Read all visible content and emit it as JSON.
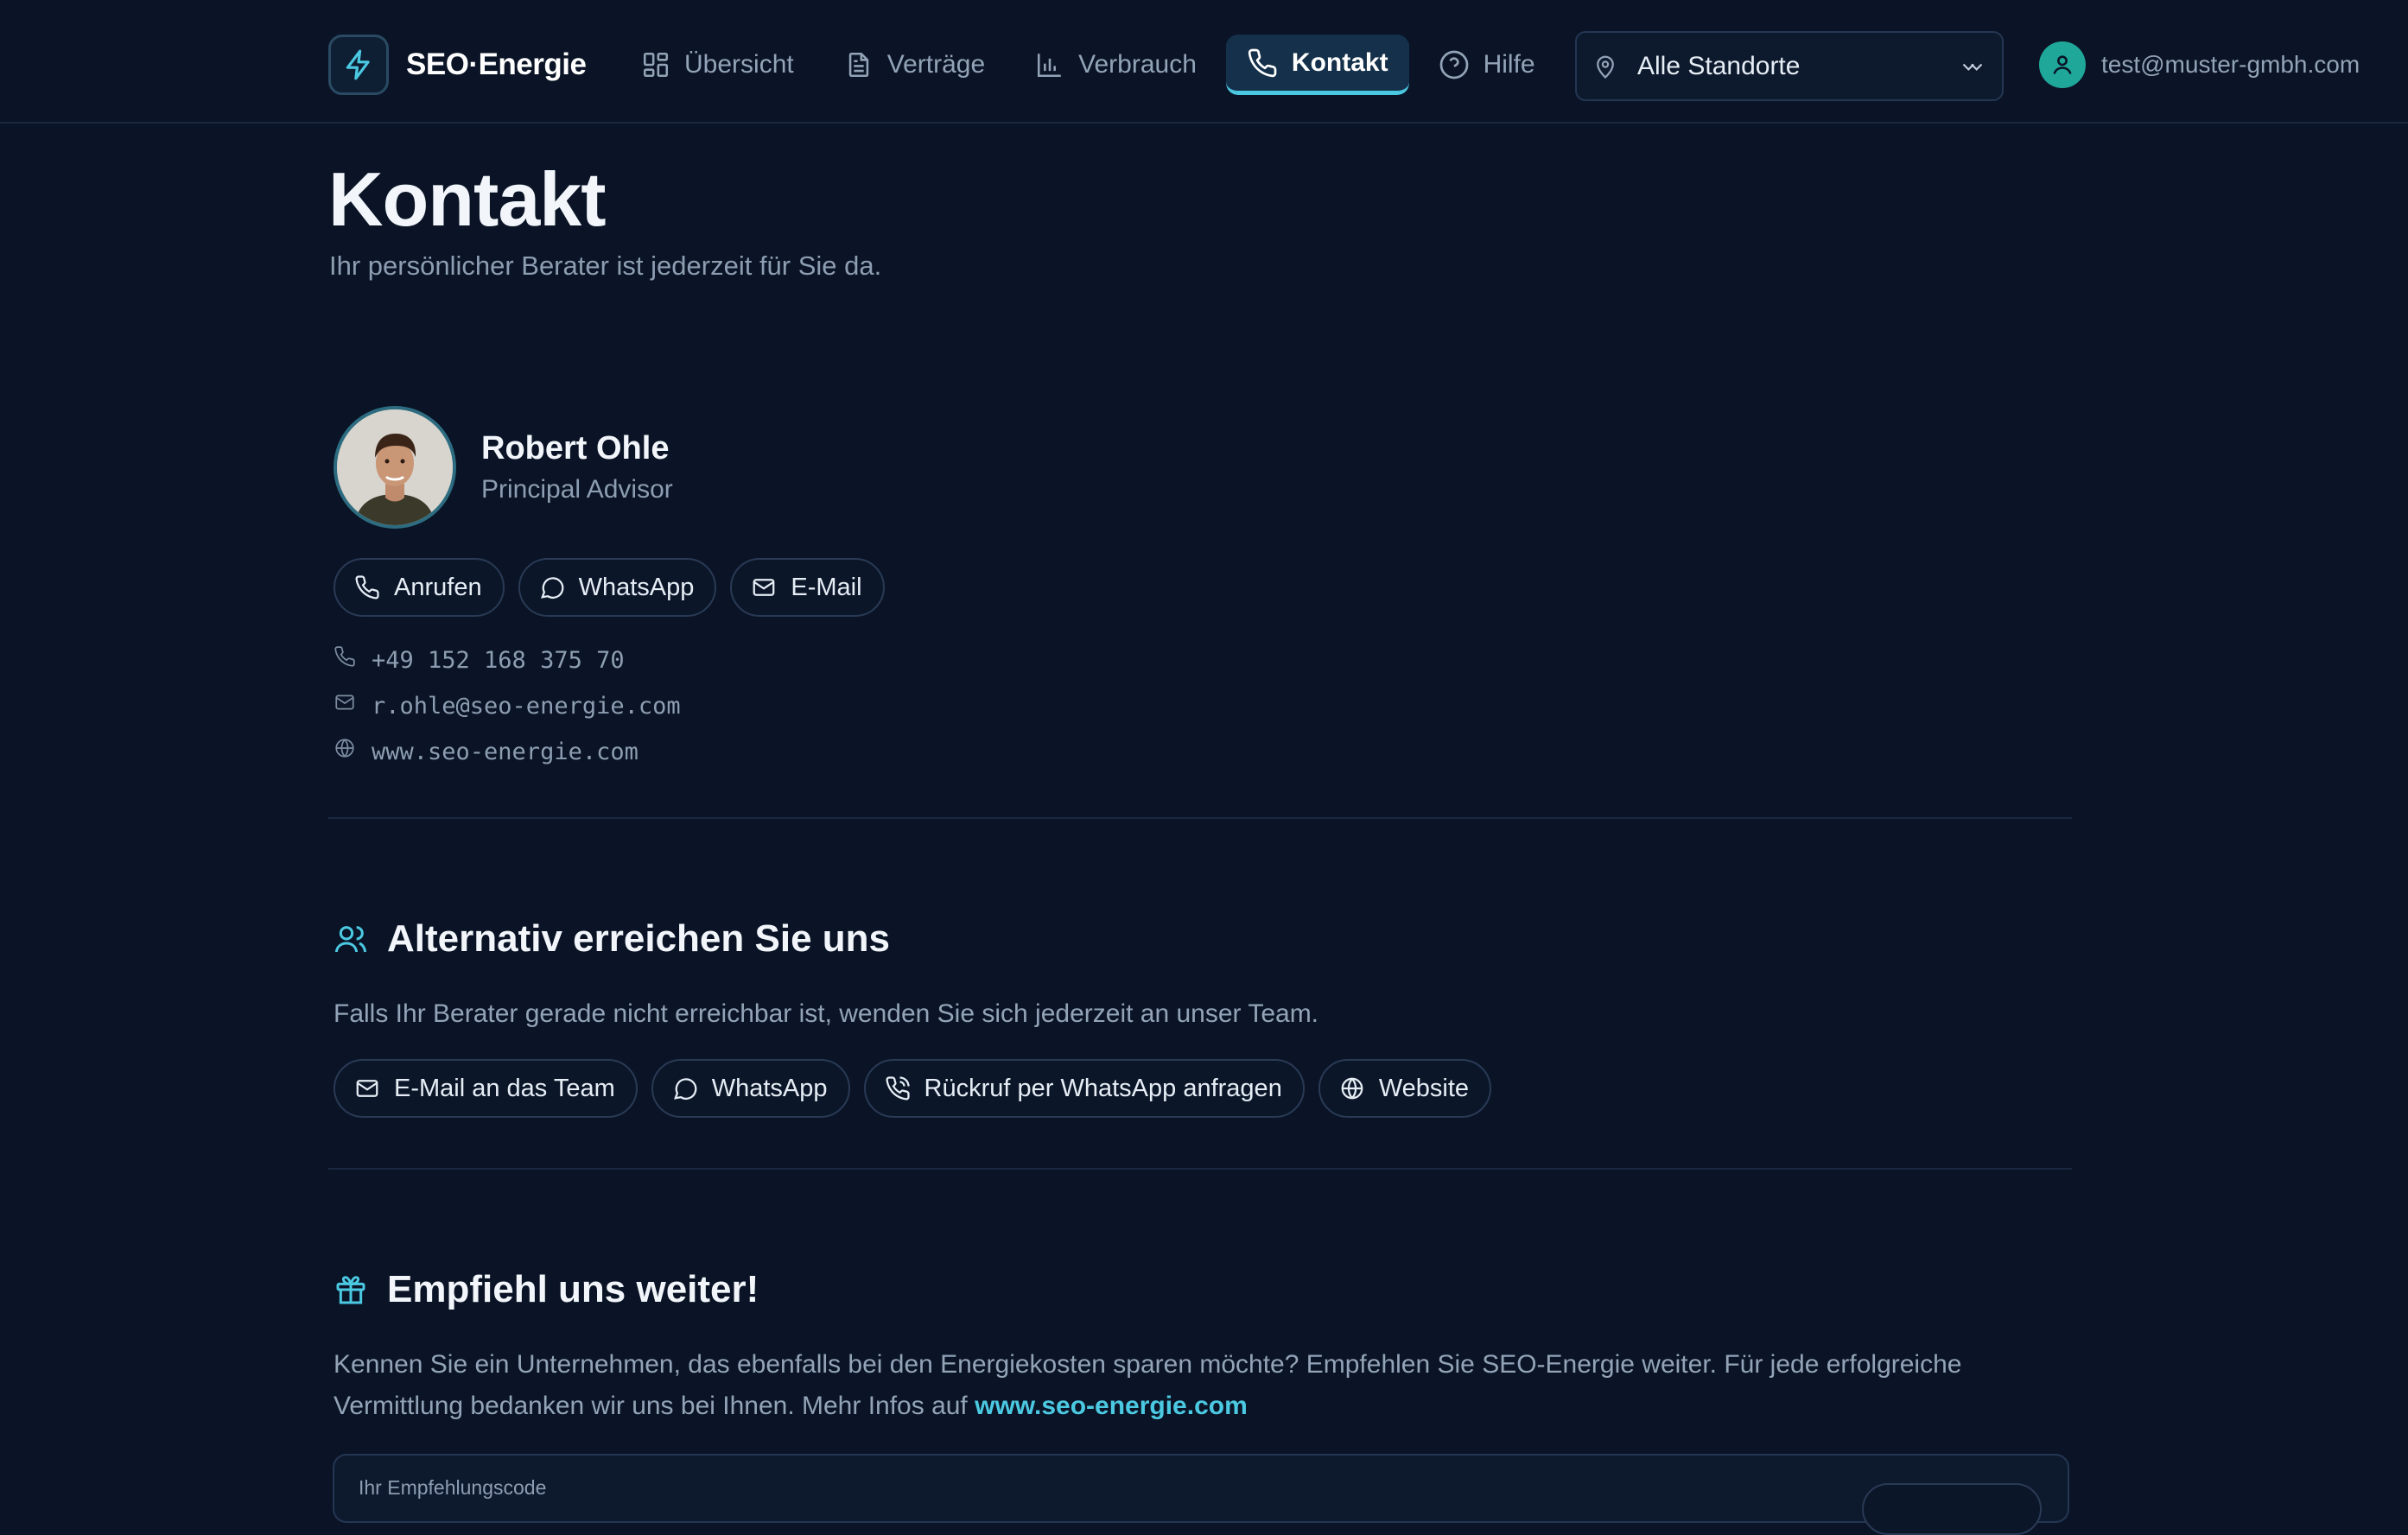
{
  "brand": {
    "name": "SEO·Energie",
    "icon": "lightning-bolt-icon"
  },
  "nav": [
    {
      "label": "Übersicht",
      "icon": "dashboard-grid-icon",
      "active": false
    },
    {
      "label": "Verträge",
      "icon": "document-icon",
      "active": false
    },
    {
      "label": "Verbrauch",
      "icon": "bar-chart-icon",
      "active": false
    },
    {
      "label": "Kontakt",
      "icon": "phone-icon",
      "active": true
    },
    {
      "label": "Hilfe",
      "icon": "help-circle-icon",
      "active": false
    }
  ],
  "location_select": {
    "value": "Alle Standorte",
    "icon": "map-pin-icon"
  },
  "user": {
    "email": "test@muster-gmbh.com",
    "icon": "user-icon"
  },
  "page": {
    "title": "Kontakt",
    "subtitle": "Ihr persönlicher Berater ist jederzeit für Sie da."
  },
  "advisor": {
    "name": "Robert Ohle",
    "role": "Principal Advisor",
    "actions": [
      {
        "label": "Anrufen",
        "icon": "phone-icon"
      },
      {
        "label": "WhatsApp",
        "icon": "chat-bubble-icon"
      },
      {
        "label": "E-Mail",
        "icon": "mail-icon"
      }
    ],
    "phone": "+49 152 168 375 70",
    "email": "r.ohle@seo-energie.com",
    "website": "www.seo-energie.com"
  },
  "alternative": {
    "title": "Alternativ erreichen Sie uns",
    "icon": "users-icon",
    "text": "Falls Ihr Berater gerade nicht erreichbar ist, wenden Sie sich jederzeit an unser Team.",
    "actions": [
      {
        "label": "E-Mail an das Team",
        "icon": "mail-icon"
      },
      {
        "label": "WhatsApp",
        "icon": "chat-bubble-icon"
      },
      {
        "label": "Rückruf per WhatsApp anfragen",
        "icon": "phone-callback-icon"
      },
      {
        "label": "Website",
        "icon": "globe-icon"
      }
    ]
  },
  "referral": {
    "title": "Empfiehl uns weiter!",
    "icon": "gift-icon",
    "text_line1": "Kennen Sie ein Unternehmen, das ebenfalls bei den Energiekosten sparen möchte? Empfehlen Sie SEO-Energie weiter. Für jede erfolgreiche",
    "text_line2": "Vermittlung bedanken wir uns bei Ihnen. Mehr Infos auf ",
    "link": "www.seo-energie.com",
    "code_label": "Ihr Empfehlungscode"
  },
  "colors": {
    "background": "#0a1426",
    "accent": "#4cc9e2",
    "avatar": "#1fa89a"
  }
}
